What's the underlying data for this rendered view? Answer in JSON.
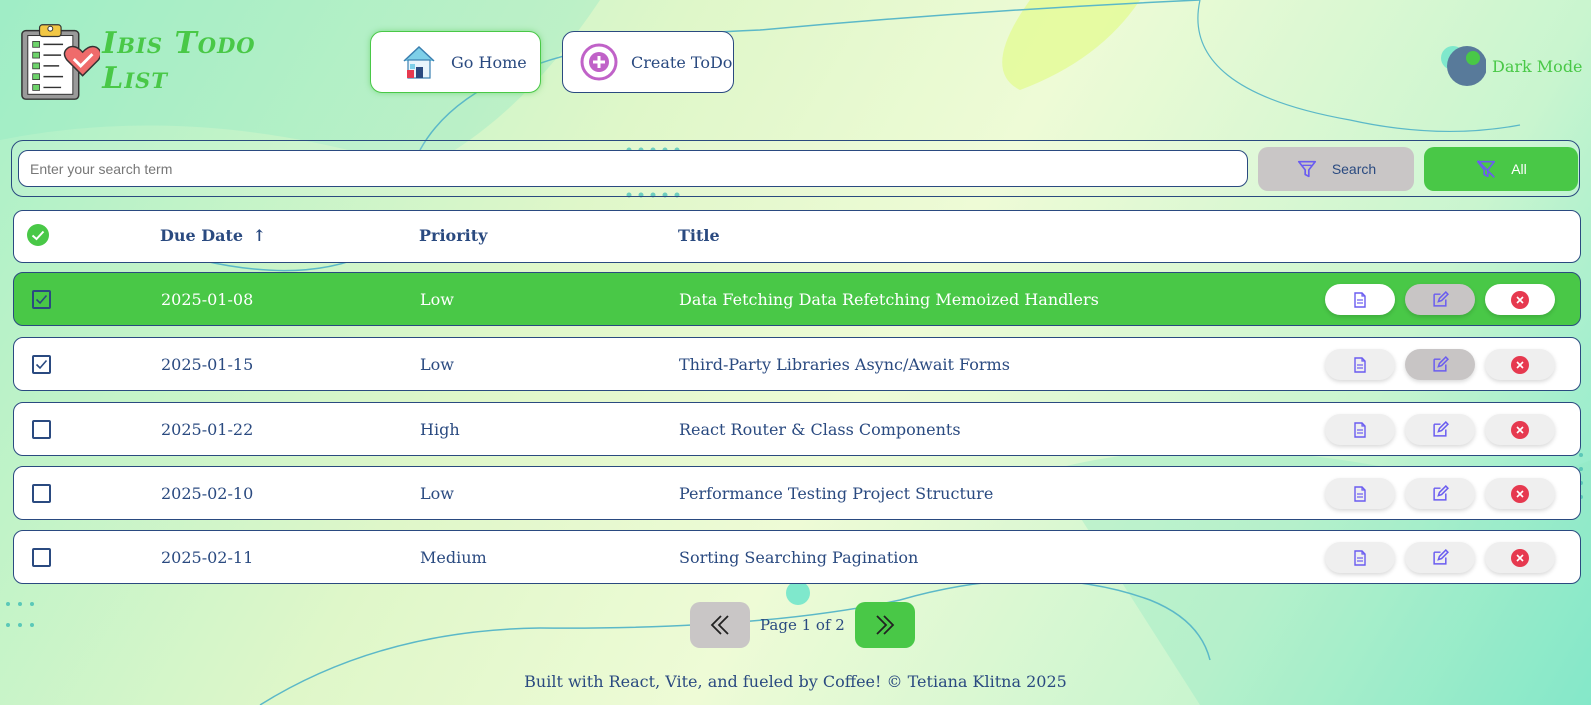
{
  "app": {
    "title": "Ibis Todo List"
  },
  "nav": {
    "home_label": "Go Home",
    "create_label": "Create ToDo"
  },
  "theme": {
    "dark_mode_label": "Dark Mode"
  },
  "search": {
    "placeholder": "Enter your search term",
    "value": "",
    "search_label": "Search",
    "all_label": "All"
  },
  "table": {
    "columns": {
      "due_date": "Due Date",
      "sort_arrow": "↑",
      "priority": "Priority",
      "title": "Title"
    },
    "rows": [
      {
        "due_date": "2025-01-08",
        "priority": "Low",
        "title": "Data Fetching Data Refetching Memoized Handlers",
        "completed": true
      },
      {
        "due_date": "2025-01-15",
        "priority": "Low",
        "title": "Third-Party Libraries Async/Await Forms",
        "completed": true
      },
      {
        "due_date": "2025-01-22",
        "priority": "High",
        "title": "React Router & Class Components",
        "completed": false
      },
      {
        "due_date": "2025-02-10",
        "priority": "Low",
        "title": "Performance Testing Project Structure",
        "completed": false
      },
      {
        "due_date": "2025-02-11",
        "priority": "Medium",
        "title": "Sorting Searching Pagination",
        "completed": false
      }
    ]
  },
  "pagination": {
    "label": "Page 1 of 2"
  },
  "footer": {
    "text": "Built with React, Vite, and fueled by Coffee! © Tetiana Klitna 2025"
  },
  "colors": {
    "accent": "#49c847",
    "text": "#2a4a80",
    "delete": "#e6394f",
    "icon": "#6a5cf0"
  },
  "icons": [
    "clipboard-heart-icon",
    "house-icon",
    "plus-circle-icon",
    "filter-icon",
    "filter-off-icon",
    "check-circle-icon",
    "document-icon",
    "edit-icon",
    "close-circle-icon",
    "chevrons-left-icon",
    "chevrons-right-icon"
  ]
}
